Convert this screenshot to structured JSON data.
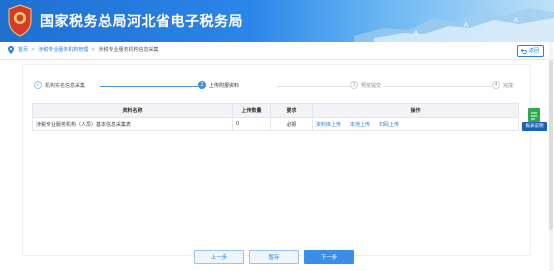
{
  "header": {
    "title": "国家税务总局河北省电子税务局",
    "emblem_text": "中国税务"
  },
  "breadcrumb": {
    "items": [
      "首页",
      "涉税专业服务机构管理",
      "涉税专业服务机构信息采集"
    ],
    "back_label": "返回"
  },
  "steps": [
    {
      "number": "1",
      "label": "机构实名信息采集",
      "status": "done"
    },
    {
      "number": "2",
      "label": "上传附报资料",
      "status": "active"
    },
    {
      "number": "3",
      "label": "预览提交",
      "status": "todo"
    },
    {
      "number": "4",
      "label": "完成",
      "status": "todo"
    }
  ],
  "table": {
    "headers": [
      "资料名称",
      "上传数量",
      "要求",
      "操作"
    ],
    "rows": [
      {
        "name": "涉税专业服务机构（人员）基本信息采集表",
        "count": "0",
        "requirement": "必报",
        "actions": [
          "资料库上传",
          "本地上传",
          "扫码上传"
        ]
      }
    ]
  },
  "side_tab": {
    "label": "报表说明"
  },
  "buttons": {
    "prev": "上一步",
    "save": "暂存",
    "next": "下一步"
  },
  "colors": {
    "primary": "#3b8ee8",
    "link": "#2a7ee0",
    "header": "#1f6fd0",
    "side_tab_icon": "#2fa84f"
  }
}
